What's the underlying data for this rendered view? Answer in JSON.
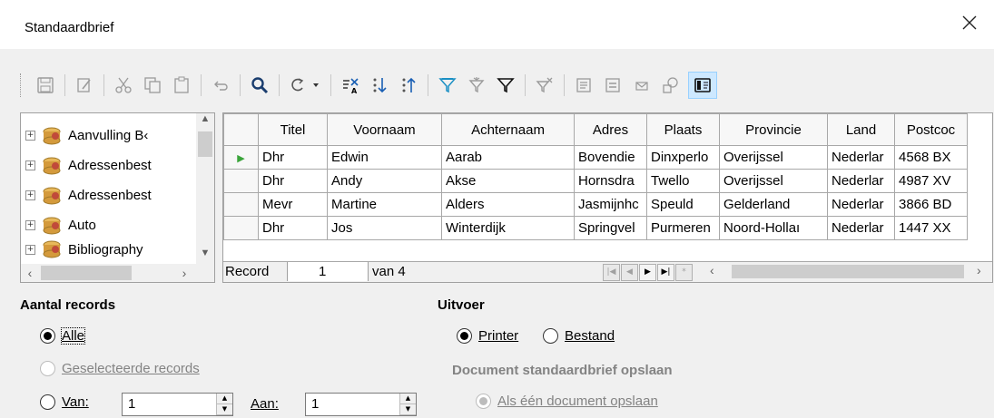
{
  "window": {
    "title": "Standaardbrief"
  },
  "toolbar": {
    "buttons": [
      "save-icon",
      "edit-icon",
      "cut-icon",
      "copy-icon",
      "paste-icon",
      "undo-icon",
      "find-icon",
      "refresh-icon",
      "autofilter-icon",
      "sort-ascending-icon",
      "sort-descending-icon",
      "apply-filter-icon",
      "autofilter-funnel-icon",
      "standard-filter-icon",
      "reset-filter-icon",
      "data-to-text-icon",
      "data-to-fields-icon",
      "mail-merge-icon",
      "data-source-icon",
      "explorer-icon"
    ]
  },
  "tree": {
    "items": [
      {
        "label": "Aanvulling B‹"
      },
      {
        "label": "Adressenbest"
      },
      {
        "label": "Adressenbest"
      },
      {
        "label": "Auto"
      },
      {
        "label": "Bibliography"
      }
    ]
  },
  "grid": {
    "columns": [
      "Titel",
      "Voornaam",
      "Achternaam",
      "Adres",
      "Plaats",
      "Provincie",
      "Land",
      "Postcoc"
    ],
    "rows": [
      [
        "Dhr",
        "Edwin",
        "Aarab",
        "Bovendie",
        "Dinxperlo",
        "Overijssel",
        "Nederlar",
        "4568 BX"
      ],
      [
        "Dhr",
        "Andy",
        "Akse",
        "Hornsdra",
        "Twello",
        "Overijssel",
        "Nederlar",
        "4987 XV"
      ],
      [
        "Mevr",
        "Martine",
        "Alders",
        "Jasmijnhc",
        "Speuld",
        "Gelderland",
        "Nederlar",
        "3866 BD"
      ],
      [
        "Dhr",
        "Jos",
        "Winterdijk",
        "Springvel",
        "Purmeren",
        "Noord-Hollaı",
        "Nederlar",
        "1447 XX"
      ]
    ],
    "nav": {
      "record_label": "Record",
      "record_value": "1",
      "of_label": "van 4"
    }
  },
  "records": {
    "heading": "Aantal records",
    "all": "Alle",
    "selected": "Geselecteerde records",
    "from_label": "Van:",
    "from_value": "1",
    "to_label": "Aan:",
    "to_value": "1"
  },
  "output": {
    "heading": "Uitvoer",
    "printer": "Printer",
    "file": "Bestand",
    "save_heading": "Document standaardbrief opslaan",
    "save_single": "Als één document opslaan"
  }
}
